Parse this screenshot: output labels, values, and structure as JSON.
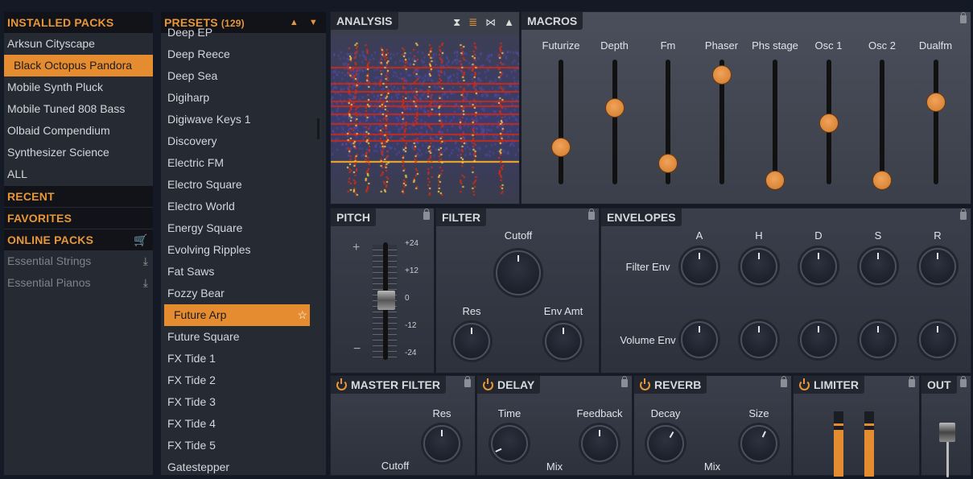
{
  "colors": {
    "accent": "#e58c31",
    "background": "#141a25"
  },
  "sidebar": {
    "installed_header": "INSTALLED PACKS",
    "installed": [
      "Arksun Cityscape",
      "Black Octopus Pandora",
      "Mobile Synth Pluck",
      "Mobile Tuned 808 Bass",
      "Olbaid Compendium",
      "Synthesizer Science",
      "ALL"
    ],
    "selected": "Black Octopus Pandora",
    "recent": "RECENT",
    "favorites": "FAVORITES",
    "online_header": "ONLINE PACKS",
    "online": [
      "Essential Strings",
      "Essential Pianos"
    ]
  },
  "presets": {
    "header": "PRESETS",
    "count": "(129)",
    "items": [
      "Deep EP",
      "Deep Reece",
      "Deep Sea",
      "Digiharp",
      "Digiwave Keys 1",
      "Discovery",
      "Electric FM",
      "Electro Square",
      "Electro World",
      "Energy Square",
      "Evolving Ripples",
      "Fat Saws",
      "Fozzy Bear",
      "Future Arp",
      "Future Square",
      "FX Tide 1",
      "FX Tide 2",
      "FX Tide 3",
      "FX Tide 4",
      "FX Tide 5",
      "Gatestepper"
    ],
    "selected": "Future Arp"
  },
  "analysis": {
    "title": "ANALYSIS",
    "icons": [
      "waveform-icon",
      "spectrogram-icon",
      "stereo-icon",
      "spectrum-icon"
    ],
    "active_icon": "spectrogram-icon"
  },
  "macros": {
    "title": "MACROS",
    "sliders": [
      {
        "label": "Futurize",
        "value": 0.3
      },
      {
        "label": "Depth",
        "value": 0.61
      },
      {
        "label": "Fm",
        "value": 0.17
      },
      {
        "label": "Phaser",
        "value": 0.88
      },
      {
        "label": "Phs stage",
        "value": 0.03
      },
      {
        "label": "Osc 1",
        "value": 0.49
      },
      {
        "label": "Osc 2",
        "value": 0.03
      },
      {
        "label": "Dualfm",
        "value": 0.66
      }
    ]
  },
  "pitch": {
    "title": "PITCH",
    "ticks": [
      "+24",
      "+12",
      "0",
      "-12",
      "-24"
    ],
    "value": 0,
    "plus": "+",
    "minus": "−"
  },
  "filter": {
    "title": "FILTER",
    "cutoff": "Cutoff",
    "res": "Res",
    "env_amt": "Env Amt"
  },
  "envelopes": {
    "title": "ENVELOPES",
    "columns": [
      "A",
      "H",
      "D",
      "S",
      "R"
    ],
    "rows": [
      "Filter Env",
      "Volume Env"
    ]
  },
  "master_filter": {
    "title": "MASTER FILTER",
    "res": "Res",
    "cutoff": "Cutoff"
  },
  "delay": {
    "title": "DELAY",
    "time": "Time",
    "feedback": "Feedback",
    "mix": "Mix"
  },
  "reverb": {
    "title": "REVERB",
    "decay": "Decay",
    "size": "Size",
    "mix": "Mix"
  },
  "limiter": {
    "title": "LIMITER"
  },
  "out": {
    "title": "OUT"
  }
}
